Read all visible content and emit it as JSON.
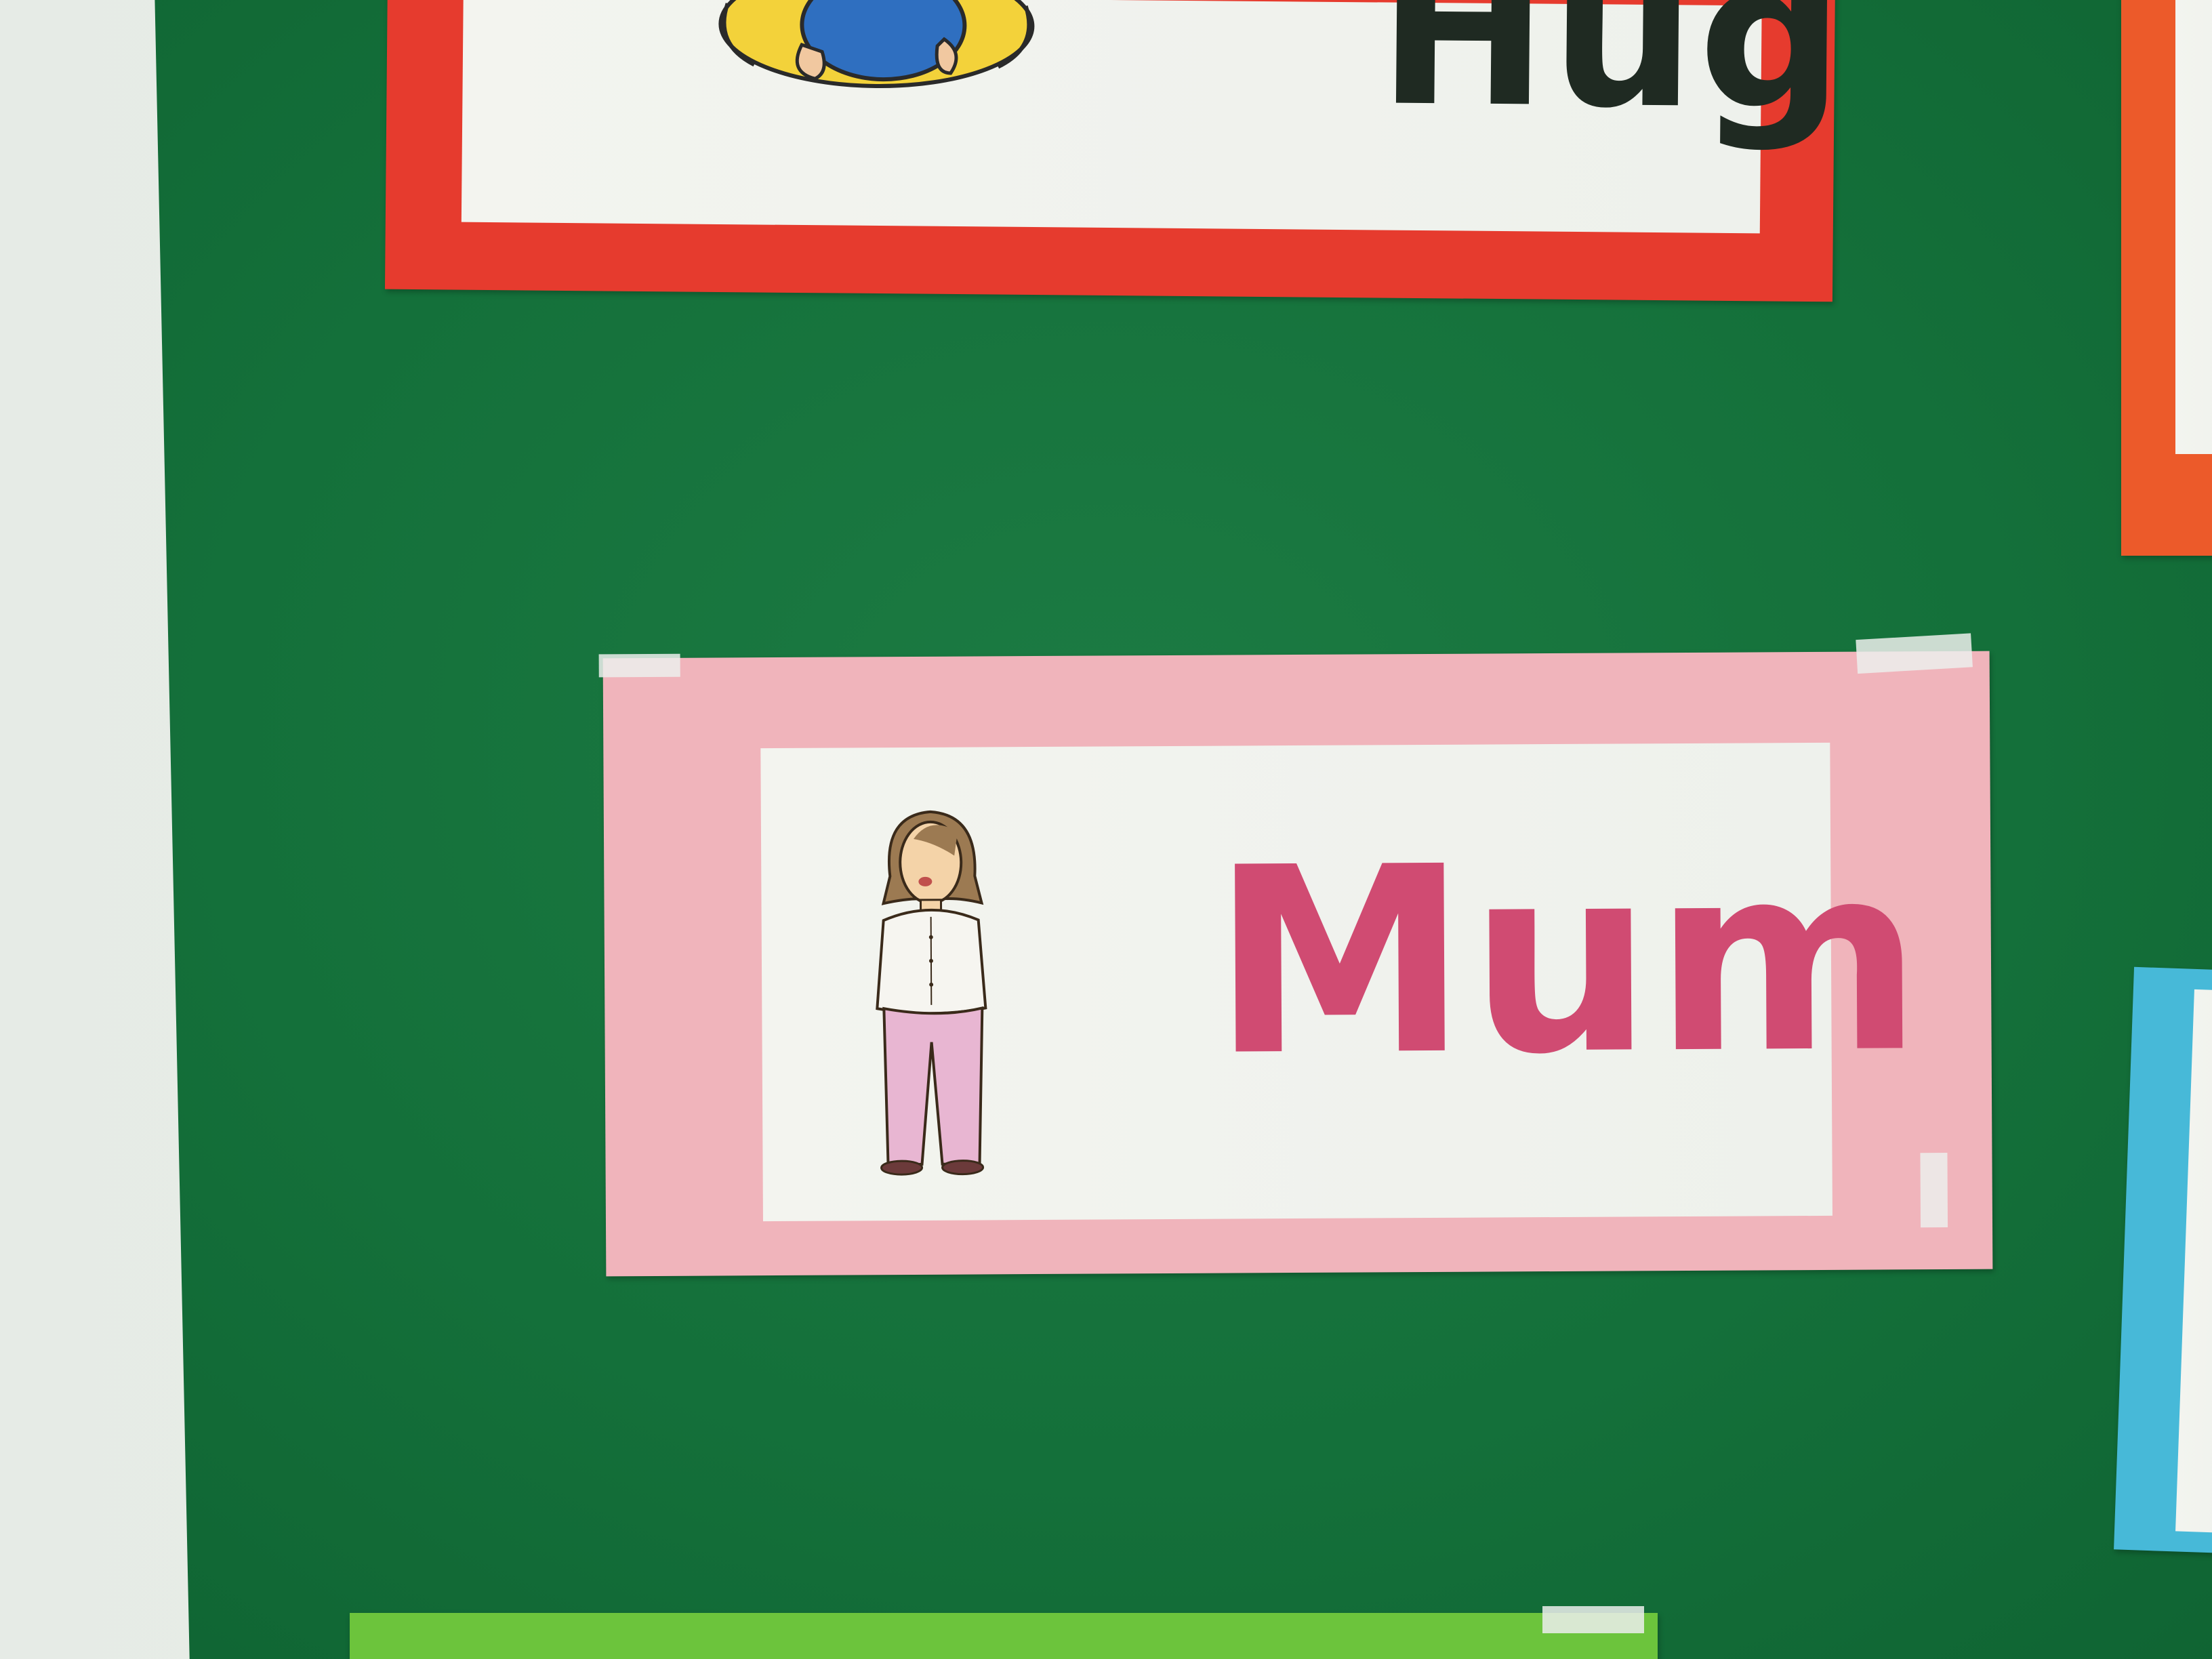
{
  "scene": {
    "board_color": "#14703a",
    "wall_color": "#e8ece6"
  },
  "cards": {
    "hug": {
      "word": "Hug",
      "frame_color": "#e63b2e",
      "text_color": "#1f2a22"
    },
    "mum": {
      "word": "Mum",
      "frame_color": "#f0b4bb",
      "text_color": "#d04b72",
      "illustration": "woman-figure"
    },
    "right_top": {
      "frame_color": "#ec5a2a"
    },
    "right_bottom": {
      "frame_color": "#47b9d8"
    },
    "bottom": {
      "frame_color": "#6cc43c"
    }
  }
}
